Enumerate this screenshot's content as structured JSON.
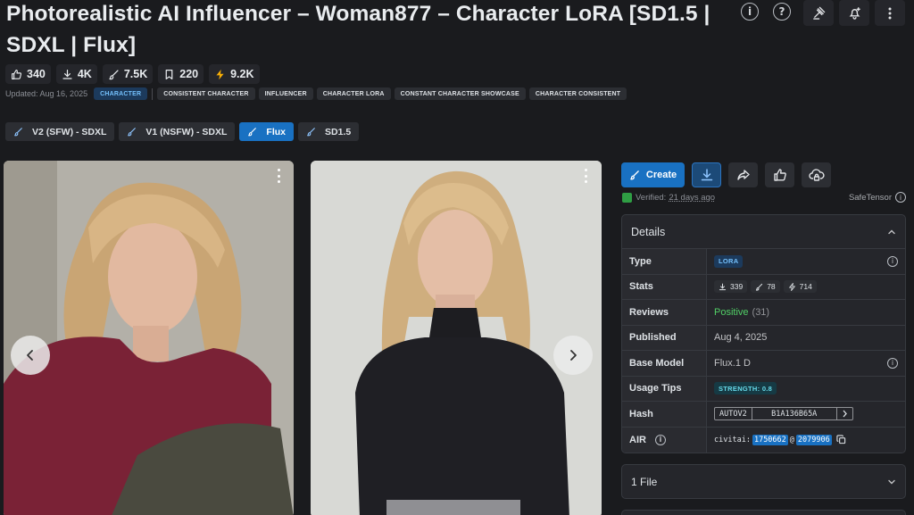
{
  "model": {
    "title": "Photorealistic AI Influencer – Woman877 – Character LoRA [SD1.5 | SDXL | Flux]"
  },
  "top_actions": {
    "info_label": "i",
    "help_label": "?"
  },
  "stats": {
    "likes": "340",
    "downloads": "4K",
    "generations": "7.5K",
    "bookmarks": "220",
    "buzz": "9.2K"
  },
  "meta": {
    "updated": "Updated: Aug 16, 2025",
    "tags": [
      "CHARACTER",
      "CONSISTENT CHARACTER",
      "INFLUENCER",
      "CHARACTER LORA",
      "CONSTANT CHARACTER SHOWCASE",
      "CHARACTER CONSISTENT"
    ]
  },
  "versions": [
    {
      "label": "V2 (SFW) - SDXL",
      "active": false
    },
    {
      "label": "V1 (NSFW) - SDXL",
      "active": false
    },
    {
      "label": "Flux",
      "active": true
    },
    {
      "label": "SD1.5",
      "active": false
    }
  ],
  "actions": {
    "create_label": "Create"
  },
  "verification": {
    "prefix": "Verified:",
    "date": "21 days ago",
    "safetensor": "SafeTensor"
  },
  "details": {
    "header": "Details",
    "type_label": "Type",
    "type_value": "LORA",
    "stats_label": "Stats",
    "stats_downloads": "339",
    "stats_generations": "78",
    "stats_buzz": "714",
    "reviews_label": "Reviews",
    "reviews_sentiment": "Positive",
    "reviews_count": "(31)",
    "published_label": "Published",
    "published_value": "Aug 4, 2025",
    "base_model_label": "Base Model",
    "base_model_value": "Flux.1 D",
    "usage_tips_label": "Usage Tips",
    "usage_tips_value": "STRENGTH: 0.8",
    "hash_label": "Hash",
    "hash_type": "AUTOV2",
    "hash_value": "B1A136B65A",
    "air_label": "AIR",
    "air_prefix": "civitai:",
    "air_model_id": "1750662",
    "air_at": "@",
    "air_version_id": "2079906"
  },
  "files": {
    "label": "1 File"
  },
  "colors": {
    "accent": "#1971c2",
    "positive": "#51cf66",
    "background": "#1a1b1e",
    "panel": "#25262b"
  }
}
